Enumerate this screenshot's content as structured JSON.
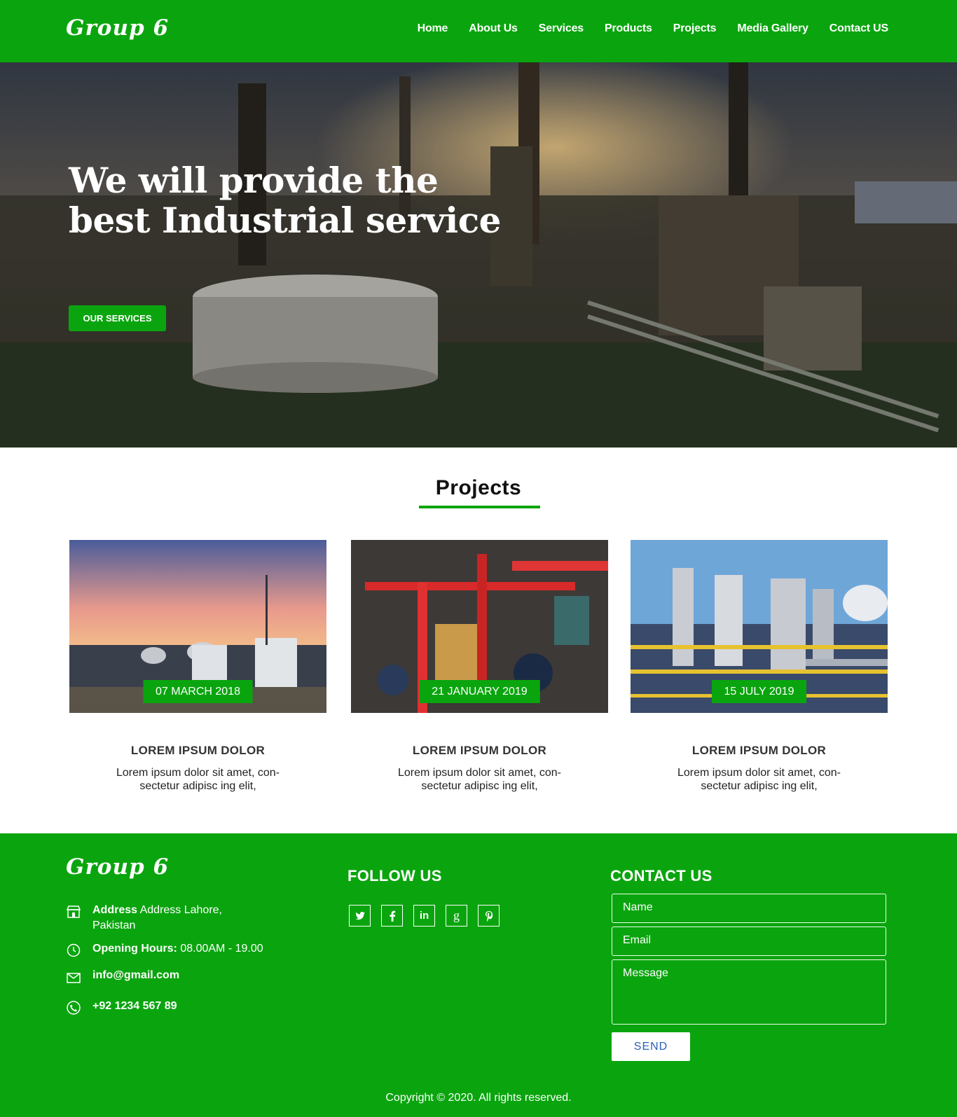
{
  "header": {
    "logo": "Group 6",
    "nav": [
      "Home",
      "About Us",
      "Services",
      "Products",
      "Projects",
      "Media Gallery",
      "Contact US"
    ]
  },
  "hero": {
    "title_line1": "We will provide the",
    "title_line2": "best Industrial service",
    "button": "OUR SERVICES"
  },
  "projects": {
    "title": "Projects",
    "cards": [
      {
        "date": "07 MARCH 2018",
        "title": "LOREM IPSUM DOLOR",
        "text1": "Lorem ipsum dolor sit amet, con-",
        "text2": "sectetur adipisc ing elit,"
      },
      {
        "date": "21 JANUARY 2019",
        "title": "LOREM IPSUM DOLOR",
        "text1": "Lorem ipsum dolor sit amet, con-",
        "text2": "sectetur adipisc ing elit,"
      },
      {
        "date": "15 JULY 2019",
        "title": "LOREM IPSUM DOLOR",
        "text1": "Lorem ipsum dolor sit amet, con-",
        "text2": "sectetur adipisc ing elit,"
      }
    ]
  },
  "footer": {
    "logo": "Group 6",
    "address_label": "Address",
    "address_value": "Address Lahore,",
    "address_value2": "Pakistan",
    "hours_label": "Opening Hours:",
    "hours_value": "08.00AM - 19.00",
    "email": "info@gmail.com",
    "phone": "+92 1234 567 89",
    "follow_heading": "FOLLOW US",
    "social_icons": [
      "twitter-icon",
      "facebook-icon",
      "linkedin-icon",
      "google-plus-icon",
      "pinterest-icon"
    ],
    "contact_heading": "CONTACT US",
    "name_placeholder": "Name",
    "email_placeholder": "Email",
    "message_placeholder": "Message",
    "send": "SEND",
    "copyright": "Copyright © 2020. All rights reserved."
  },
  "colors": {
    "brand_green": "#0aa50e",
    "send_text": "#2b5fb8"
  }
}
